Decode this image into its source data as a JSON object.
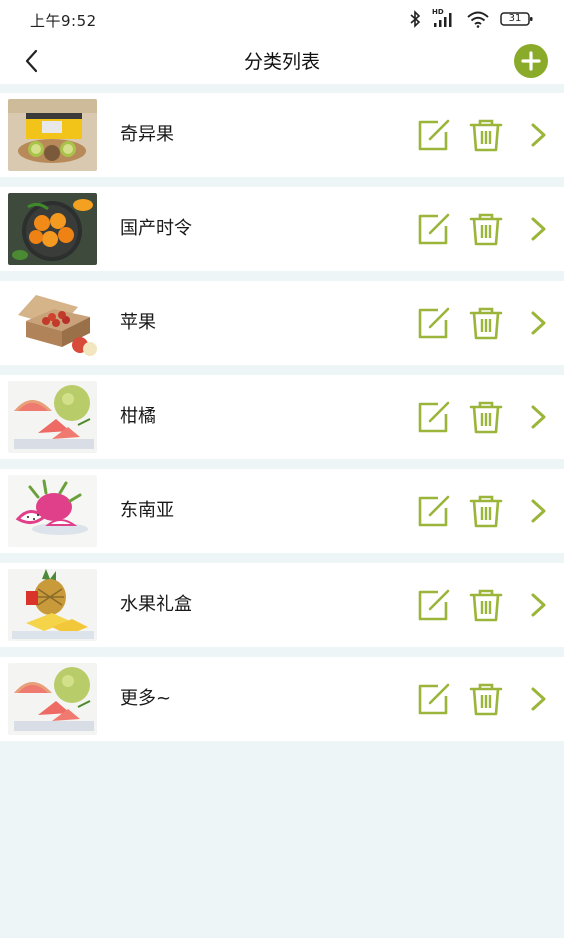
{
  "status": {
    "time": "上午9:52",
    "network_label": "HD",
    "battery": "31"
  },
  "header": {
    "title": "分类列表"
  },
  "colors": {
    "accent": "#8aaa2a",
    "page_bg": "#eef5f6"
  },
  "categories": [
    {
      "label": "奇异果",
      "image": "kiwi-gift-box"
    },
    {
      "label": "国产时令",
      "image": "oranges-bowl"
    },
    {
      "label": "苹果",
      "image": "apple-box"
    },
    {
      "label": "柑橘",
      "image": "pomelo"
    },
    {
      "label": "东南亚",
      "image": "dragon-fruit"
    },
    {
      "label": "水果礼盒",
      "image": "pineapple"
    },
    {
      "label": "更多~",
      "image": "pomelo"
    }
  ]
}
